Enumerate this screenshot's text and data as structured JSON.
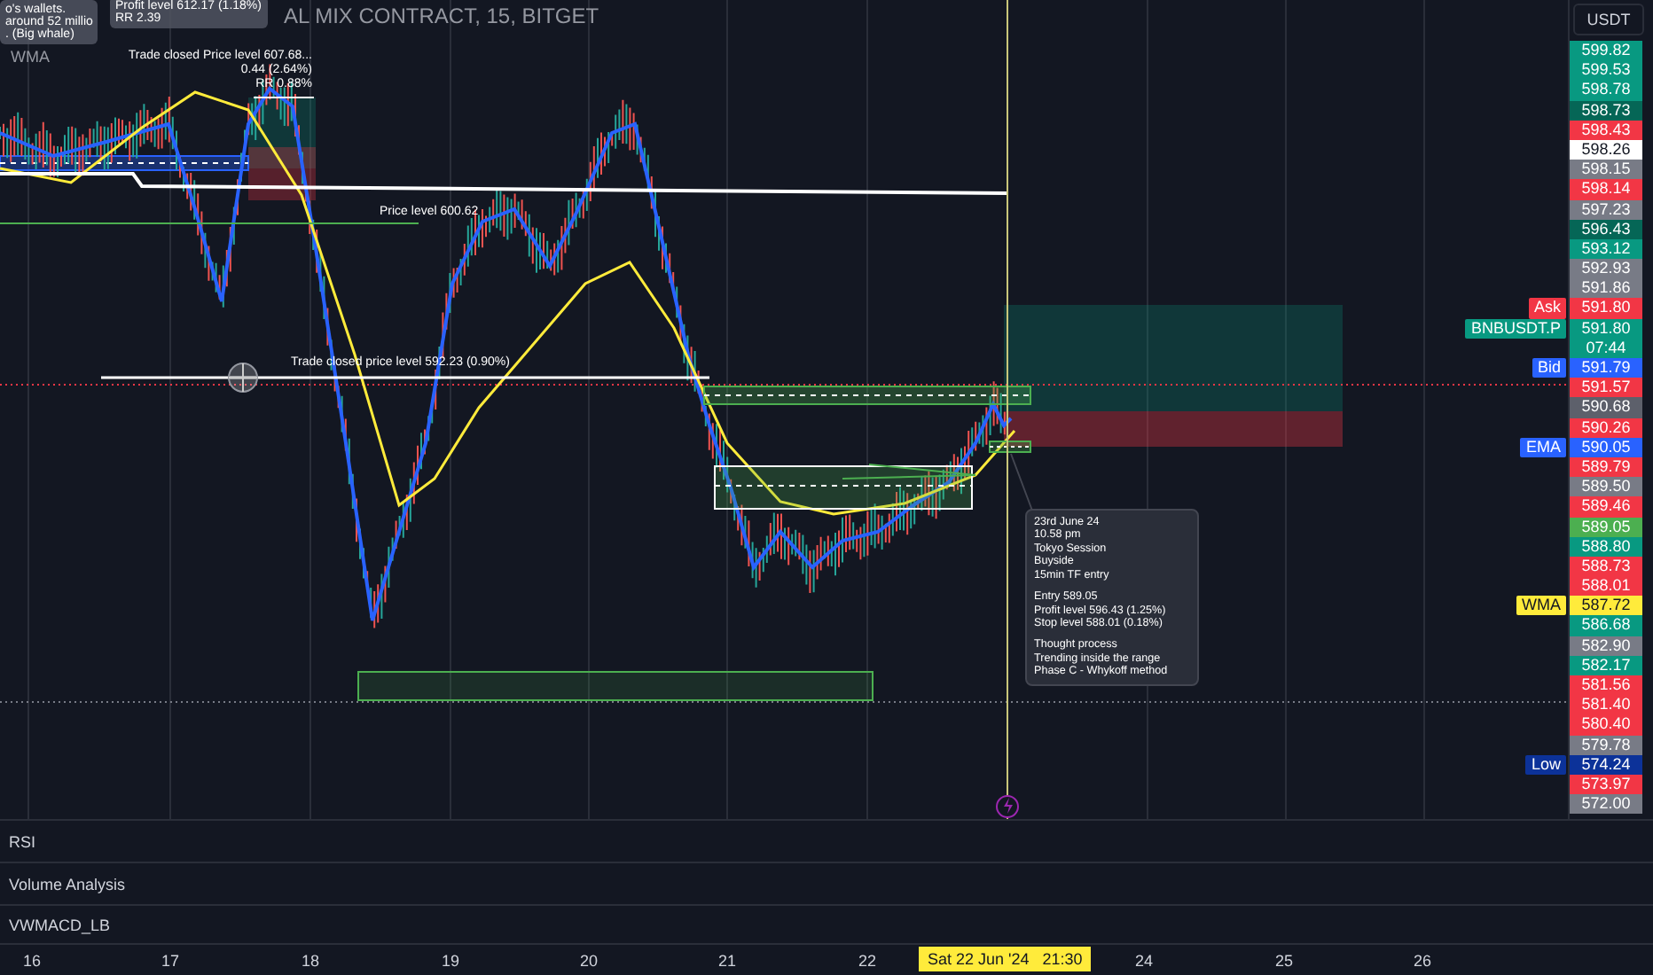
{
  "header": {
    "title": "AL MIX CONTRACT, 15, BITGET",
    "currency": "USDT"
  },
  "chart": {
    "top_note": [
      "o's wallets.",
      "around 52 millio",
      ". (Big whale)"
    ],
    "top_label": "WMA",
    "top_tooltip": [
      "Profit level 612.17 (1.18%)",
      "RR 2.39"
    ],
    "trade_closed_top": [
      "Trade closed Price level 607.68...",
      "0.44 (2.64%)",
      "RR 0.88%"
    ],
    "price_level_label": "Price level 600.62",
    "trade_closed_mid": "Trade closed price level 592.23 (0.90%)",
    "note": [
      [
        "23rd June 24",
        "10.58 pm",
        "Tokyo Session",
        "Buyside",
        "15min TF entry"
      ],
      [
        "Entry 589.05",
        "Profit level 596.43 (1.25%)",
        "Stop level 588.01 (0.18%)"
      ],
      [
        "Thought process",
        "Trending inside the range",
        "Phase C - Whykoff method"
      ]
    ]
  },
  "price_axis": {
    "labels": [
      {
        "price": "599.82",
        "color": "#089981"
      },
      {
        "price": "599.53",
        "color": "#089981"
      },
      {
        "price": "598.78",
        "color": "#089981"
      },
      {
        "price": "598.73",
        "color": "#056656"
      },
      {
        "price": "598.43",
        "color": "#f23645"
      },
      {
        "price": "598.26",
        "color": "#ffffff"
      },
      {
        "price": "598.15",
        "color": "#787b86"
      },
      {
        "price": "598.14",
        "color": "#f23645"
      },
      {
        "price": "597.23",
        "color": "#787b86"
      },
      {
        "price": "596.43",
        "color": "#056656"
      },
      {
        "price": "593.12",
        "color": "#089981"
      },
      {
        "price": "592.93",
        "color": "#787b86"
      },
      {
        "price": "591.86",
        "color": "#787b86"
      },
      {
        "price": "591.80",
        "color": "#f23645",
        "tag": "Ask"
      },
      {
        "price": "591.80",
        "sub": "07:44",
        "color": "#089981",
        "tag": "BNBUSDT.P"
      },
      {
        "price": "591.79",
        "color": "#2962ff",
        "tag": "Bid"
      },
      {
        "price": "591.57",
        "color": "#f23645"
      },
      {
        "price": "590.68",
        "color": "#5d606b"
      },
      {
        "price": "590.26",
        "color": "#f23645"
      },
      {
        "price": "590.05",
        "color": "#2962ff",
        "tag": "EMA"
      },
      {
        "price": "589.79",
        "color": "#f23645"
      },
      {
        "price": "589.50",
        "color": "#787b86"
      },
      {
        "price": "589.46",
        "color": "#f23645"
      },
      {
        "price": "589.05",
        "color": "#4caf50"
      },
      {
        "price": "588.80",
        "color": "#089981"
      },
      {
        "price": "588.73",
        "color": "#f23645"
      },
      {
        "price": "588.01",
        "color": "#f23645"
      },
      {
        "price": "587.72",
        "color": "#ffeb3b",
        "tag": "WMA"
      },
      {
        "price": "586.68",
        "color": "#089981"
      },
      {
        "price": "582.90",
        "color": "#787b86"
      },
      {
        "price": "582.17",
        "color": "#089981"
      },
      {
        "price": "581.56",
        "color": "#f23645"
      },
      {
        "price": "581.40",
        "color": "#f23645"
      },
      {
        "price": "580.40",
        "color": "#f23645"
      },
      {
        "price": "579.78",
        "color": "#787b86"
      },
      {
        "price": "574.24",
        "color": "#0c3299",
        "tag": "Low"
      },
      {
        "price": "573.97",
        "color": "#f23645"
      },
      {
        "price": "572.00",
        "color": "#787b86"
      }
    ]
  },
  "panes": [
    "RSI",
    "Volume Analysis",
    "VWMACD_LB"
  ],
  "time_axis": {
    "ticks": [
      "16",
      "17",
      "18",
      "19",
      "20",
      "21",
      "22",
      "24",
      "25",
      "26"
    ],
    "crosshair_label": "Sat 22 Jun '24   21:30"
  }
}
